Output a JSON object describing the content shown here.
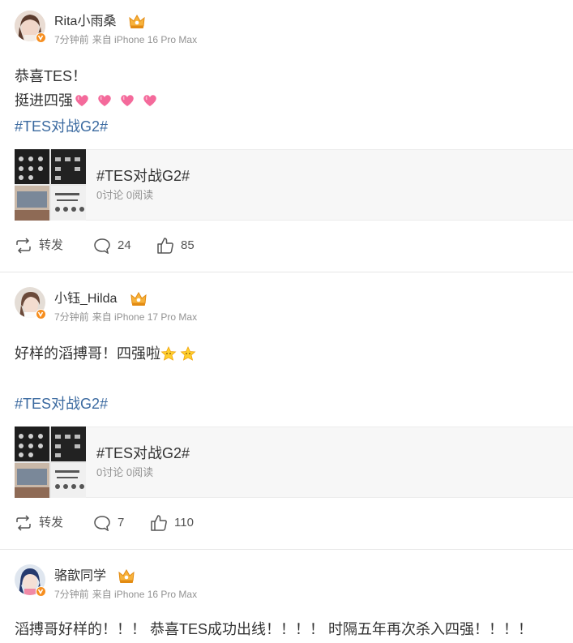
{
  "posts": [
    {
      "username": "Rita小雨桑",
      "time": "7分钟前",
      "source": "来自 iPhone 16 Pro Max",
      "lines": [
        "恭喜TES！",
        "挺进四强"
      ],
      "hashtag": "#TES对战G2#",
      "topic_card": {
        "title": "#TES对战G2#",
        "stats": "0讨论 0阅读"
      },
      "actions": {
        "repost": "转发",
        "comments": "24",
        "likes": "85"
      }
    },
    {
      "username": "小钰_Hilda",
      "time": "7分钟前",
      "source": "来自 iPhone 17 Pro Max",
      "lines": [
        "好样的滔搏哥！四强啦"
      ],
      "hashtag": "#TES对战G2#",
      "topic_card": {
        "title": "#TES对战G2#",
        "stats": "0讨论 0阅读"
      },
      "actions": {
        "repost": "转发",
        "comments": "7",
        "likes": "110"
      }
    },
    {
      "username": "骆歆同学",
      "time": "7分钟前",
      "source": "来自 iPhone 16 Pro Max",
      "lines": [
        "滔搏哥好样的！！！ 恭喜TES成功出线！！！！ 时隔五年再次杀入四强！！！！"
      ]
    }
  ],
  "icons": {
    "verified": "verified-badge-icon",
    "crown": "vip-crown-icon",
    "heart": "pink-heart-emoji",
    "star": "star-emoji",
    "repost": "repost-icon",
    "comment": "comment-icon",
    "like": "thumbs-up-icon"
  },
  "colors": {
    "hashtag": "#3b6aa0",
    "verified": "#f68e1f",
    "meta": "#939393"
  }
}
